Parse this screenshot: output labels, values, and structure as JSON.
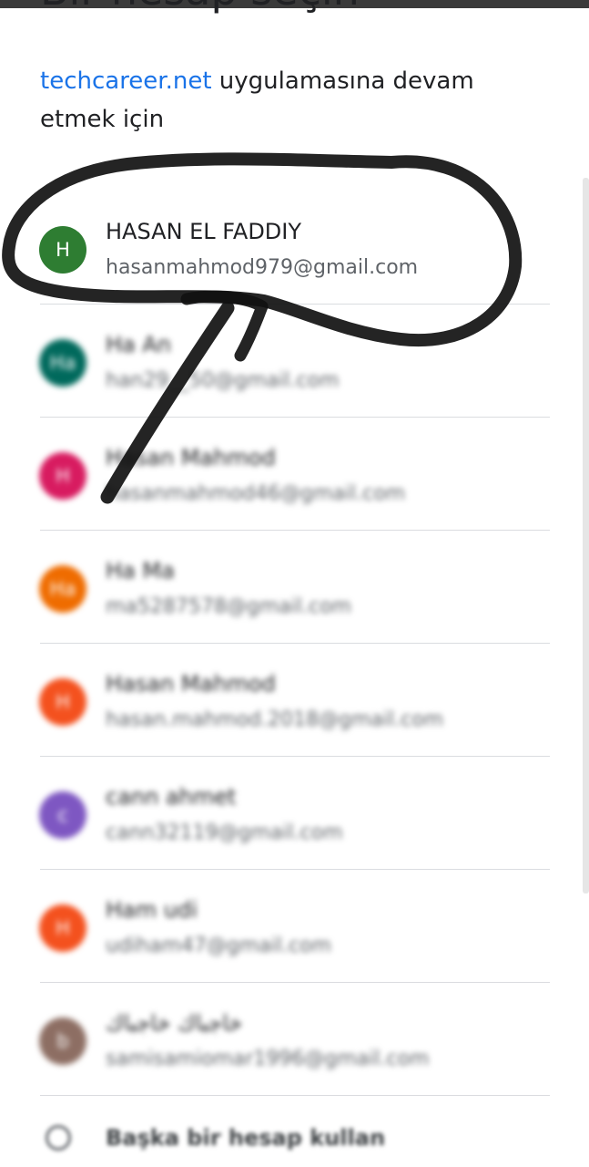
{
  "header": {
    "title": "Bir hesap seçin",
    "subtitle_link": "techcareer.net",
    "subtitle_rest": " uygulamasına devam etmek için"
  },
  "accounts": [
    {
      "initial": "H",
      "name": "HASAN EL FADDIY",
      "email": "hasanmahmod979@gmail.com",
      "color": "#2e7d32"
    },
    {
      "initial": "Ha",
      "name": "Ha An",
      "email": "han29__50@gmail.com",
      "color": "#00695c"
    },
    {
      "initial": "H",
      "name": "Hasan Mahmod",
      "email": "hasanmahmod46@gmail.com",
      "color": "#d81b60"
    },
    {
      "initial": "Ha",
      "name": "Ha Ma",
      "email": "ma5287578@gmail.com",
      "color": "#ef6c00"
    },
    {
      "initial": "H",
      "name": "Hasan Mahmod",
      "email": "hasan.mahmod.2018@gmail.com",
      "color": "#f4511e"
    },
    {
      "initial": "c",
      "name": "cann ahmet",
      "email": "cann32119@gmail.com",
      "color": "#7e57c2"
    },
    {
      "initial": "H",
      "name": "Ham udi",
      "email": "udiham47@gmail.com",
      "color": "#f4511e"
    },
    {
      "initial": "b",
      "name": "خاجباك خاجباك",
      "email": "samisamiomar1996@gmail.com",
      "color": "#8d6e63"
    }
  ],
  "footer": {
    "other_account_label": "Başka bir hesap kullan"
  },
  "icons": {
    "other_account": "person-add-icon"
  }
}
